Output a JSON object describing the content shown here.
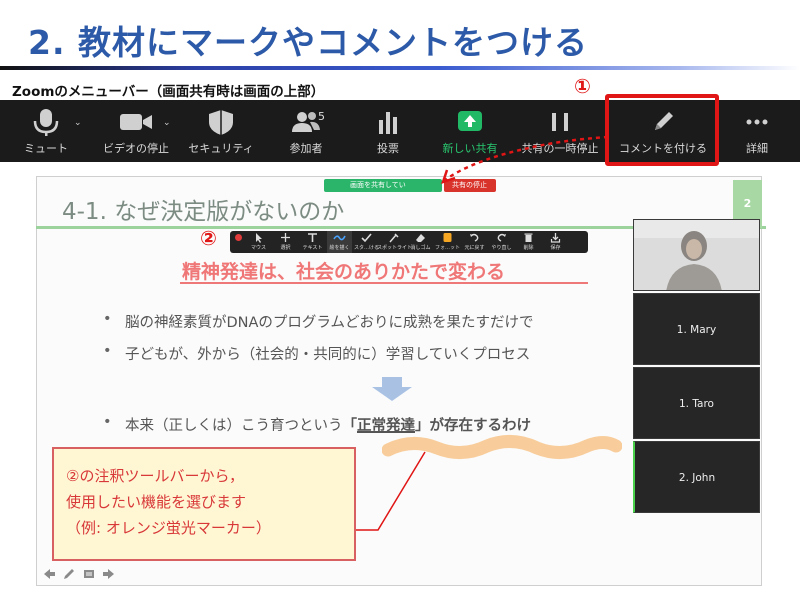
{
  "title": "2. 教材にマークやコメントをつける",
  "subtitle": "Zoomのメニューバー（画面共有時は画面の上部）",
  "badge_1": "①",
  "badge_2": "②",
  "zoom_menu": {
    "items": [
      {
        "label": "ミュート",
        "icon": "microphone-icon"
      },
      {
        "label": "ビデオの停止",
        "icon": "video-camera-icon"
      },
      {
        "label": "セキュリティ",
        "icon": "shield-icon"
      },
      {
        "label": "参加者",
        "icon": "participants-icon",
        "count": "5"
      },
      {
        "label": "投票",
        "icon": "bar-chart-icon"
      },
      {
        "label": "新しい共有",
        "icon": "share-arrow-icon"
      },
      {
        "label": "共有の一時停止",
        "icon": "pause-icon"
      },
      {
        "label": "コメントを付ける",
        "icon": "pencil-icon"
      },
      {
        "label": "詳細",
        "icon": "more-dots-icon"
      }
    ],
    "share_color": "#29c76f",
    "highlight_box_color": "#e01515"
  },
  "share_banner": {
    "sharing_text": "画面を共有してい",
    "stop_text": "共有の停止"
  },
  "slide": {
    "heading": "4-1. なぜ決定版がないのか",
    "page_number": "2",
    "headline_part1": "精神発達",
    "headline_part2": "は、社会のありかたで変わる",
    "bullets": [
      "脳の神経素質がDNAのプログラムどおりに成熟を果たすだけで",
      "子どもが、外から（社会的・共同的に）学習していくプロセス"
    ],
    "bullet3_prefix": "本来（正しくは）こう育つという",
    "bullet3_open": "「",
    "bullet3_term": "正常発達",
    "bullet3_rest": "」が存在するわけ",
    "bullet_marker": "•"
  },
  "annotation_toolbar": {
    "tools": [
      {
        "label": "マウス",
        "icon": "cursor-icon"
      },
      {
        "label": "選択",
        "icon": "move-icon"
      },
      {
        "label": "テキスト",
        "icon": "text-icon"
      },
      {
        "label": "絵を描く",
        "icon": "draw-squiggle-icon"
      },
      {
        "label": "スタ…ける",
        "icon": "stamp-check-icon"
      },
      {
        "label": "スポットライト",
        "icon": "spotlight-icon"
      },
      {
        "label": "消しゴム",
        "icon": "eraser-icon"
      },
      {
        "label": "フォ…ット",
        "icon": "format-color-icon"
      },
      {
        "label": "元に戻す",
        "icon": "undo-icon"
      },
      {
        "label": "やり直し",
        "icon": "redo-icon"
      },
      {
        "label": "削除",
        "icon": "trash-icon"
      },
      {
        "label": "保存",
        "icon": "save-icon"
      }
    ],
    "active_tool": "絵を描く",
    "highlighter_color": "#f5a623"
  },
  "participants": [
    {
      "name": "",
      "has_video": true
    },
    {
      "name": "1. Mary"
    },
    {
      "name": "1. Taro"
    },
    {
      "name": "2. John",
      "speaking": true
    }
  ],
  "callout": {
    "lines": [
      "②の注釈ツールバーから，",
      "使用したい機能を選びます",
      "（例: オレンジ蛍光マーカー）"
    ],
    "text_color": "#d83838",
    "border_color": "#d96060",
    "background": "#fff6d4"
  },
  "slide_nav": [
    "back-arrow-icon",
    "pen-icon",
    "notes-icon",
    "forward-arrow-icon"
  ]
}
